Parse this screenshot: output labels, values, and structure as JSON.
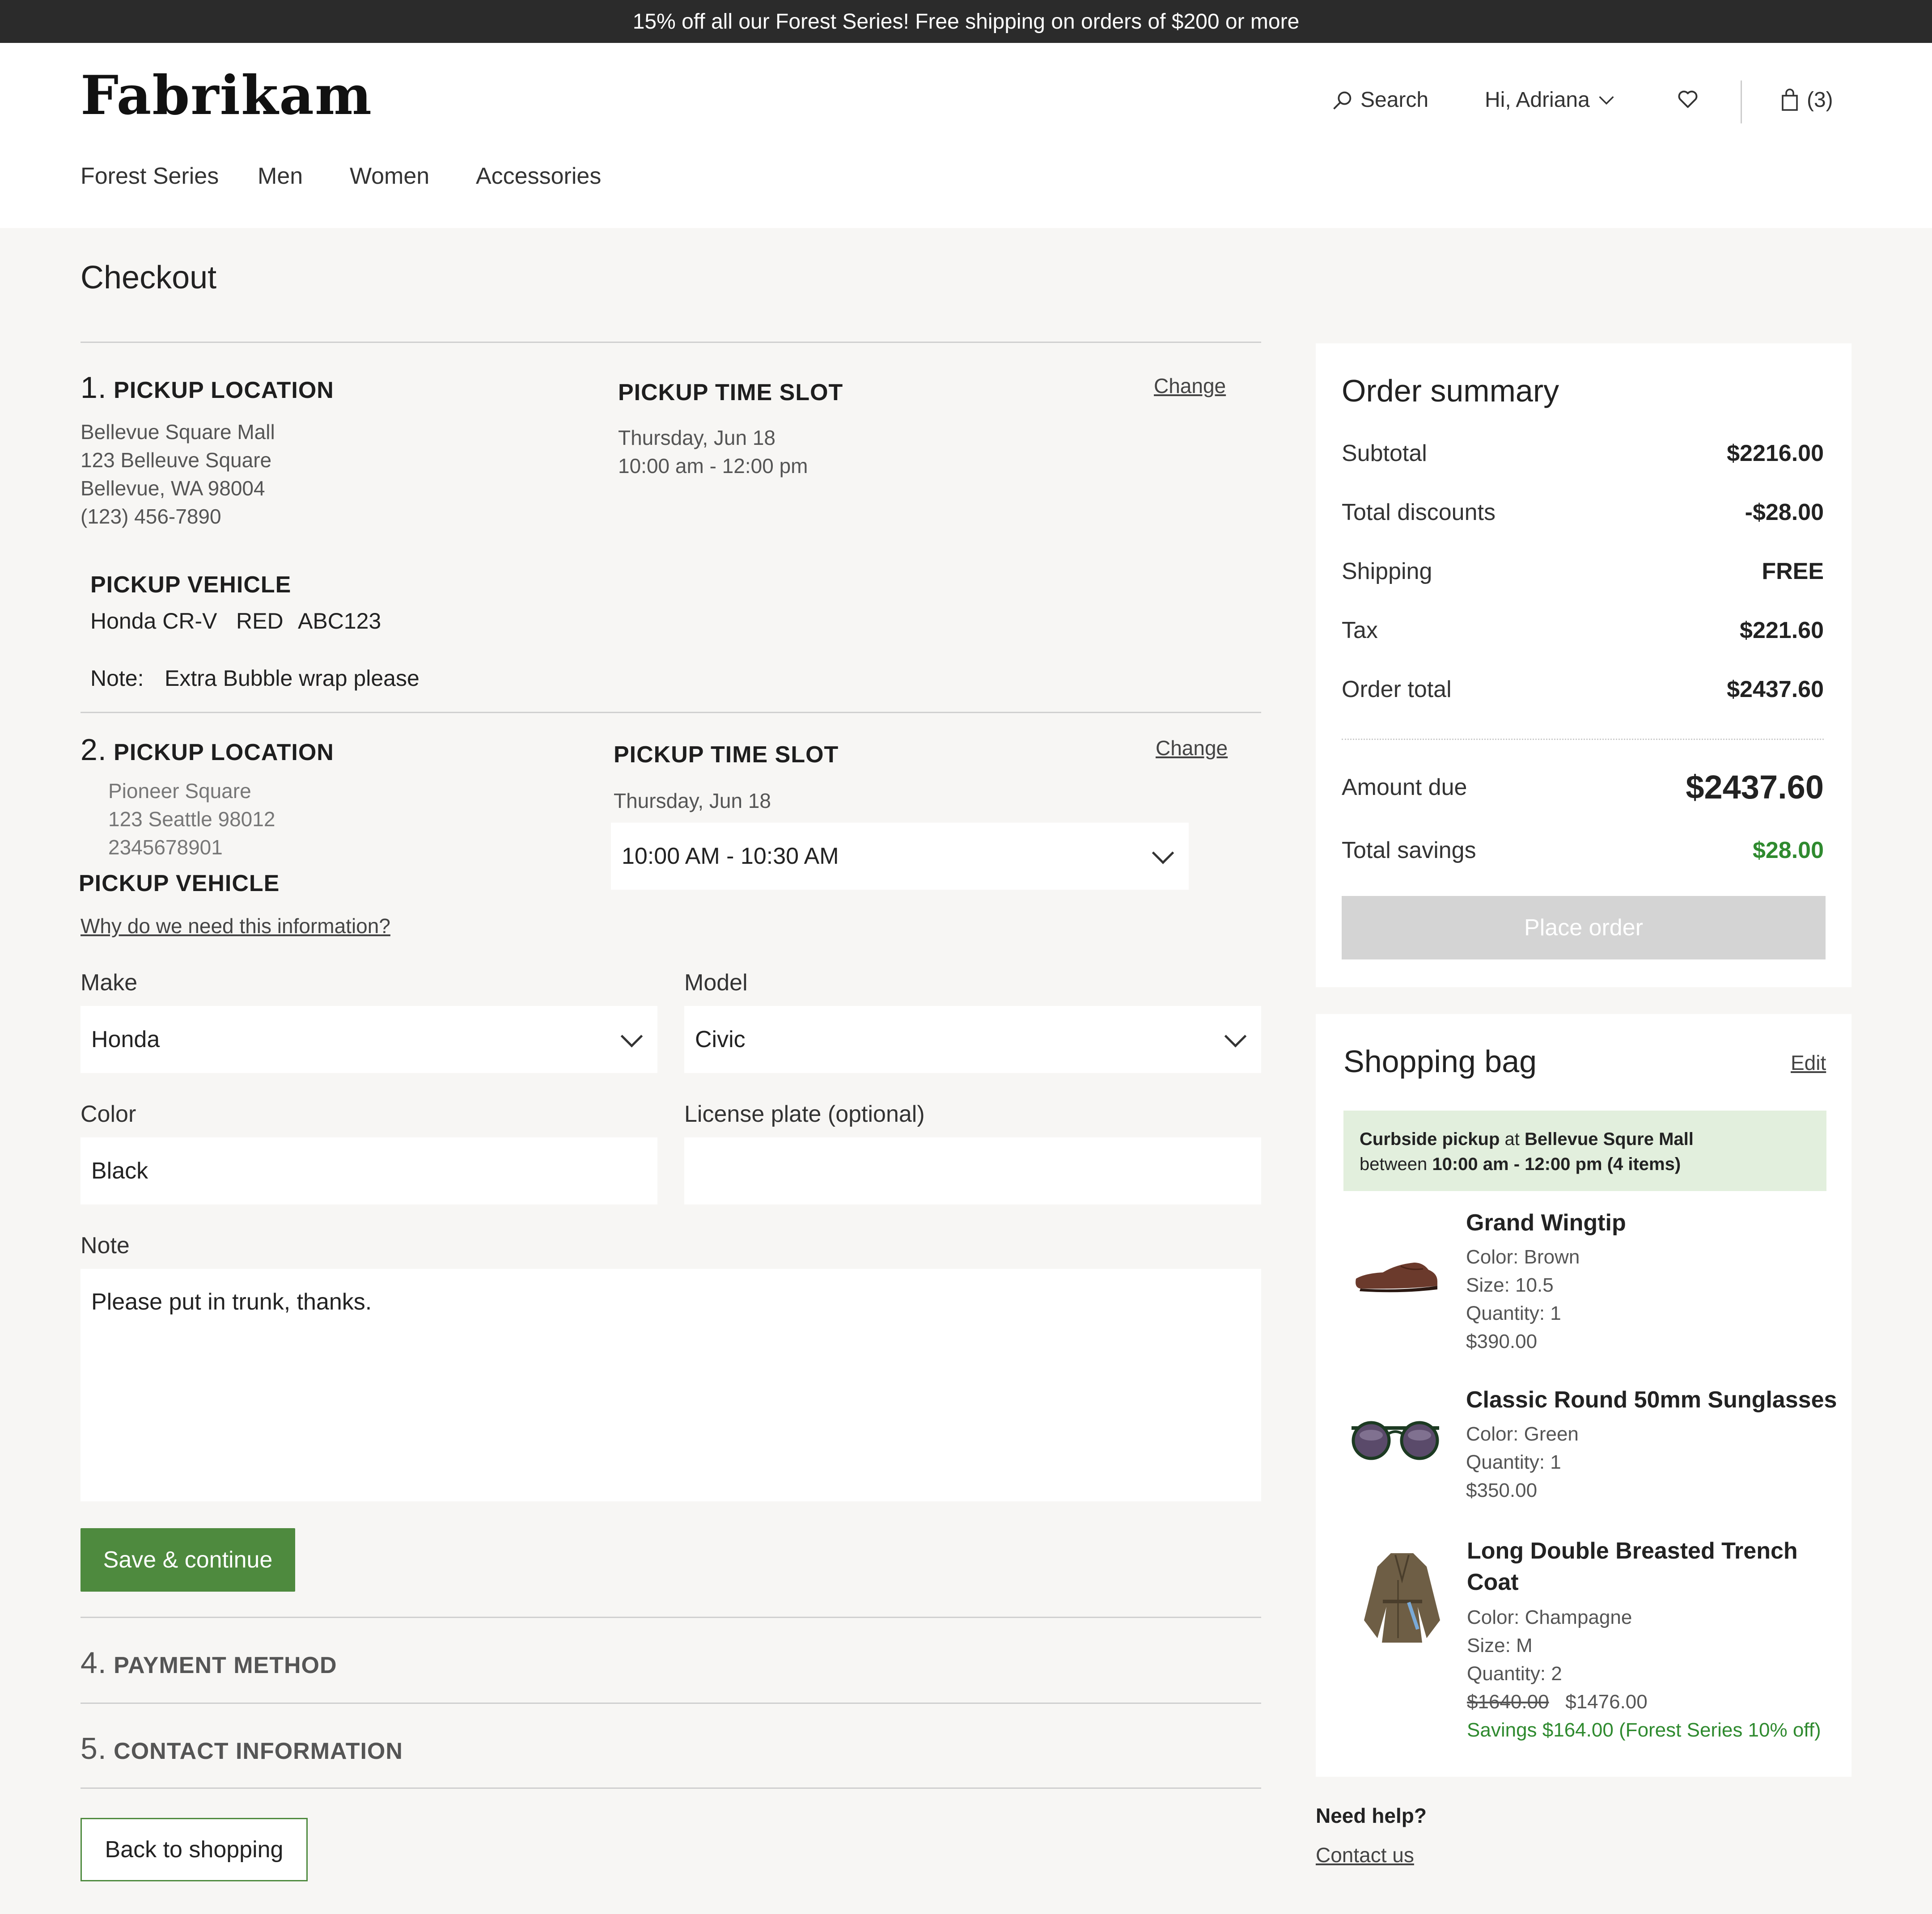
{
  "promo": {
    "text": "15% off all our Forest Series! Free shipping on orders of $200 or more"
  },
  "header": {
    "logo": "Fabrikam",
    "search_label": "Search",
    "greeting": "Hi, Adriana",
    "bag_count": "(3)",
    "nav": [
      "Forest Series",
      "Men",
      "Women",
      "Accessories"
    ]
  },
  "checkout": {
    "title": "Checkout",
    "section1": {
      "num": "1.",
      "heading": "PICKUP LOCATION",
      "address": [
        "Bellevue Square Mall",
        "123 Belleuve Square",
        "Bellevue, WA 98004",
        "(123) 456-7890"
      ],
      "timeslot_heading": "PICKUP TIME SLOT",
      "timeslot_date": "Thursday, Jun 18",
      "timeslot_time": "10:00 am - 12:00 pm",
      "change": "Change",
      "vehicle_heading": "PICKUP VEHICLE",
      "vehicle_model": "Honda CR-V",
      "vehicle_color": "RED",
      "vehicle_plate": "ABC123",
      "note_label": "Note:",
      "note_value": "Extra Bubble wrap please"
    },
    "section2": {
      "num": "2.",
      "heading": "PICKUP LOCATION",
      "address": [
        "Pioneer Square",
        "123 Seattle 98012",
        "2345678901"
      ],
      "timeslot_heading": "PICKUP TIME SLOT",
      "timeslot_date": "Thursday, Jun 18",
      "timeslot_select": "10:00 AM - 10:30 AM",
      "change": "Change",
      "vehicle_heading": "PICKUP VEHICLE",
      "why_link": "Why do we need this information?",
      "make_label": "Make",
      "make_value": "Honda",
      "model_label": "Model",
      "model_value": "Civic",
      "color_label": "Color",
      "color_value": "Black",
      "plate_label": "License plate (optional)",
      "plate_value": "",
      "note_label": "Note",
      "note_value": "Please put in trunk, thanks.",
      "save_button": "Save & continue"
    },
    "section4": {
      "num": "4.",
      "heading": "PAYMENT METHOD"
    },
    "section5": {
      "num": "5.",
      "heading": "CONTACT INFORMATION"
    },
    "back_button": "Back to shopping"
  },
  "order_summary": {
    "title": "Order summary",
    "rows": [
      {
        "label": "Subtotal",
        "value": "$2216.00"
      },
      {
        "label": "Total discounts",
        "value": "-$28.00"
      },
      {
        "label": "Shipping",
        "value": "FREE"
      },
      {
        "label": "Tax",
        "value": "$221.60"
      },
      {
        "label": "Order total",
        "value": "$2437.60"
      }
    ],
    "amount_due_label": "Amount due",
    "amount_due_value": "$2437.60",
    "savings_label": "Total savings",
    "savings_value": "$28.00",
    "place_order": "Place order"
  },
  "shopping_bag": {
    "title": "Shopping bag",
    "edit": "Edit",
    "pickup_prefix": "Curbside pickup",
    "pickup_at": " at ",
    "pickup_store": "Bellevue Squre Mall",
    "pickup_between": "between ",
    "pickup_window": "10:00 am - 12:00 pm (4 items)",
    "items": [
      {
        "name": "Grand Wingtip",
        "color": "Color: Brown",
        "size": "Size: 10.5",
        "qty": "Quantity: 1",
        "price": "$390.00"
      },
      {
        "name": "Classic Round 50mm Sunglasses",
        "color": "Color: Green",
        "qty": "Quantity: 1",
        "price": "$350.00"
      },
      {
        "name_line1": "Long Double Breasted Trench",
        "name_line2": "Coat",
        "color": "Color: Champagne",
        "size": "Size: M",
        "qty": "Quantity: 2",
        "old_price": "$1640.00",
        "price": "$1476.00",
        "savings": "Savings $164.00 (Forest Series 10% off)"
      }
    ]
  },
  "help": {
    "title": "Need help?",
    "link": "Contact us"
  },
  "colors": {
    "accent_green": "#4e8a3e",
    "savings_green": "#2f8a2f",
    "promo_bar": "#2b2b2b",
    "pickup_banner": "#e2efdd"
  }
}
